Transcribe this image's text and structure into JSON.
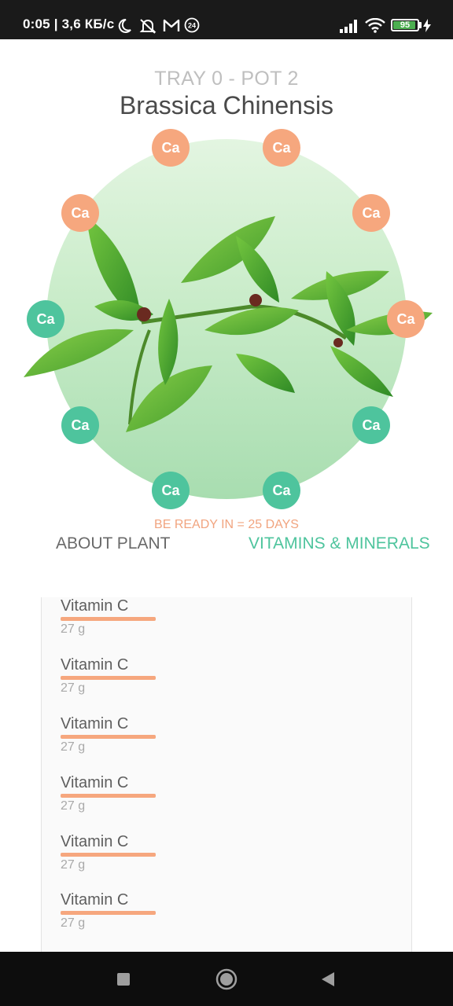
{
  "status_bar": {
    "time": "0:05 | 3,6 КБ/с",
    "battery_level": "95",
    "battery_fraction": 0.95,
    "icons": [
      "moon-icon",
      "alarm-off-icon",
      "gmail-icon",
      "notification-24-icon",
      "signal-icon",
      "wifi-icon",
      "battery-icon",
      "charging-icon"
    ]
  },
  "header": {
    "subtitle": "TRAY 0 - POT 2",
    "title": "Brassica Chinensis"
  },
  "nutrients": [
    {
      "label": "Ca",
      "color": "#f6a77e"
    },
    {
      "label": "Ca",
      "color": "#f6a77e"
    },
    {
      "label": "Ca",
      "color": "#f6a77e"
    },
    {
      "label": "Ca",
      "color": "#f6a77e"
    },
    {
      "label": "Ca",
      "color": "#f6a77e"
    },
    {
      "label": "Ca",
      "color": "#4ec49d"
    },
    {
      "label": "Ca",
      "color": "#4ec49d"
    },
    {
      "label": "Ca",
      "color": "#4ec49d"
    },
    {
      "label": "Ca",
      "color": "#4ec49d"
    },
    {
      "label": "Ca",
      "color": "#4ec49d"
    }
  ],
  "ready_text": "BE READY IN = 25 DAYS",
  "tabs": {
    "about": "ABOUT PLANT",
    "vitamins": "VITAMINS & MINERALS",
    "active": "vitamins"
  },
  "vitamins": [
    {
      "name": "Vitamin C",
      "amount": "27 g",
      "level": 1.0
    },
    {
      "name": "Vitamin C",
      "amount": "27 g",
      "level": 1.0
    },
    {
      "name": "Vitamin C",
      "amount": "27 g",
      "level": 1.0
    },
    {
      "name": "Vitamin C",
      "amount": "27 g",
      "level": 1.0
    },
    {
      "name": "Vitamin C",
      "amount": "27 g",
      "level": 1.0
    },
    {
      "name": "Vitamin C",
      "amount": "27 g",
      "level": 1.0
    }
  ],
  "colors": {
    "accent_green": "#4ec49d",
    "accent_orange": "#f6a77e",
    "title": "#4a4a4a"
  },
  "nav_icons": [
    "recent-apps-icon",
    "home-icon",
    "back-icon"
  ]
}
